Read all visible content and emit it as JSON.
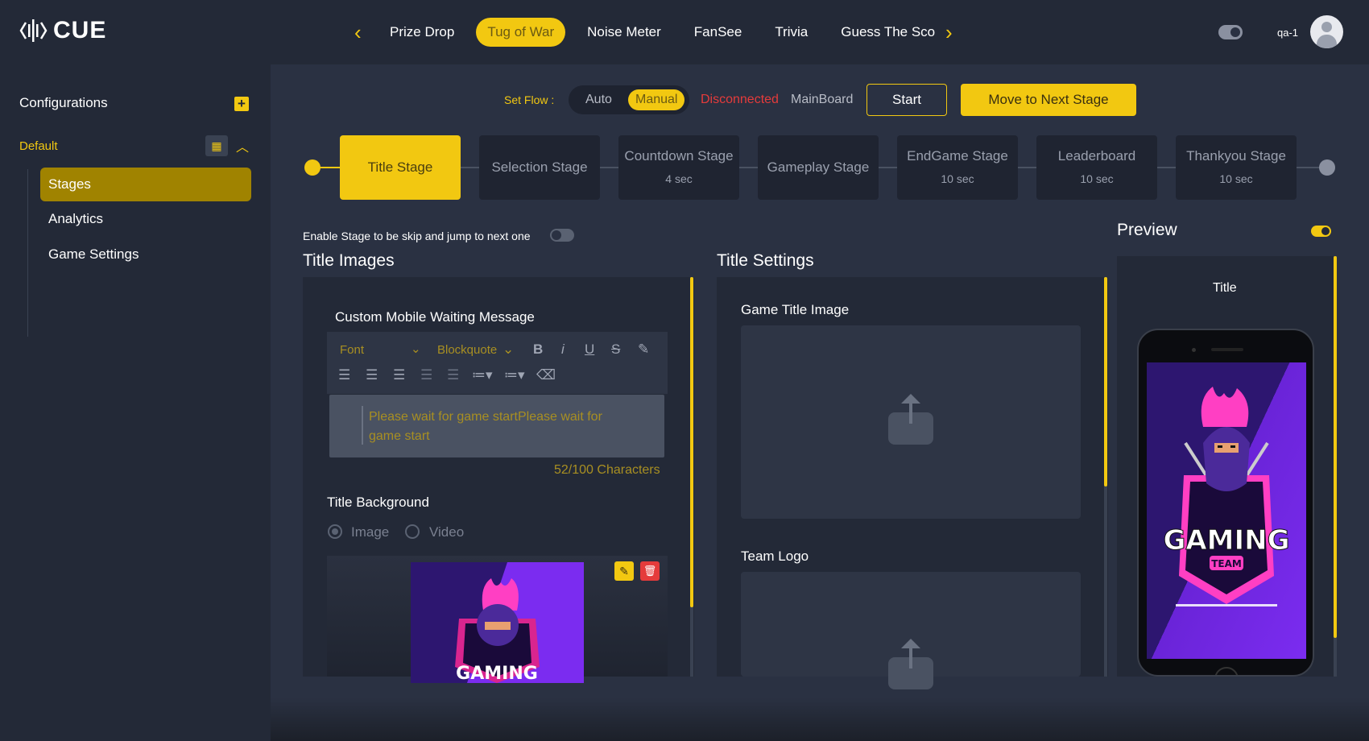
{
  "brand": {
    "name": "CUE"
  },
  "nav": {
    "tabs": [
      "Prize Drop",
      "Tug of War",
      "Noise Meter",
      "FanSee",
      "Trivia",
      "Guess The Sco"
    ],
    "active_tab": "Tug of War"
  },
  "user": {
    "name": "qa-1"
  },
  "sidebar": {
    "title": "Configurations",
    "group": "Default",
    "items": [
      {
        "label": "Stages",
        "active": true
      },
      {
        "label": "Analytics",
        "active": false
      },
      {
        "label": "Game Settings",
        "active": false
      }
    ]
  },
  "flow": {
    "label": "Set Flow :",
    "options": [
      "Auto",
      "Manual"
    ],
    "selected": "Manual",
    "status": "Disconnected",
    "board": "MainBoard",
    "start_label": "Start",
    "next_label": "Move to Next Stage"
  },
  "stages": [
    {
      "name": "Title Stage",
      "duration": "",
      "active": true
    },
    {
      "name": "Selection Stage",
      "duration": "",
      "active": false
    },
    {
      "name": "Countdown Stage",
      "duration": "4 sec",
      "active": false
    },
    {
      "name": "Gameplay Stage",
      "duration": "",
      "active": false
    },
    {
      "name": "EndGame Stage",
      "duration": "10 sec",
      "active": false
    },
    {
      "name": "Leaderboard",
      "duration": "10 sec",
      "active": false
    },
    {
      "name": "Thankyou Stage",
      "duration": "10 sec",
      "active": false
    }
  ],
  "skip": {
    "label": "Enable Stage to be skip and jump to next one",
    "enabled": false
  },
  "title_images": {
    "heading": "Title Images",
    "waiting_label": "Custom Mobile Waiting Message",
    "toolbar": {
      "font": "Font",
      "block": "Blockquote"
    },
    "message": "Please wait for game startPlease wait for game start",
    "char_count": "52/100 Characters",
    "background_label": "Title Background",
    "bg_options": [
      "Image",
      "Video"
    ],
    "bg_selected": "Image"
  },
  "title_settings": {
    "heading": "Title Settings",
    "game_title_image": "Game Title Image",
    "team_logo": "Team Logo"
  },
  "preview": {
    "heading": "Preview",
    "enabled": true,
    "title": "Title",
    "gaming_text": "GAMING",
    "team_text": "TEAM"
  },
  "colors": {
    "accent": "#f2c811",
    "bg": "#2a3142",
    "panel": "#232937",
    "danger": "#e53b3b"
  }
}
